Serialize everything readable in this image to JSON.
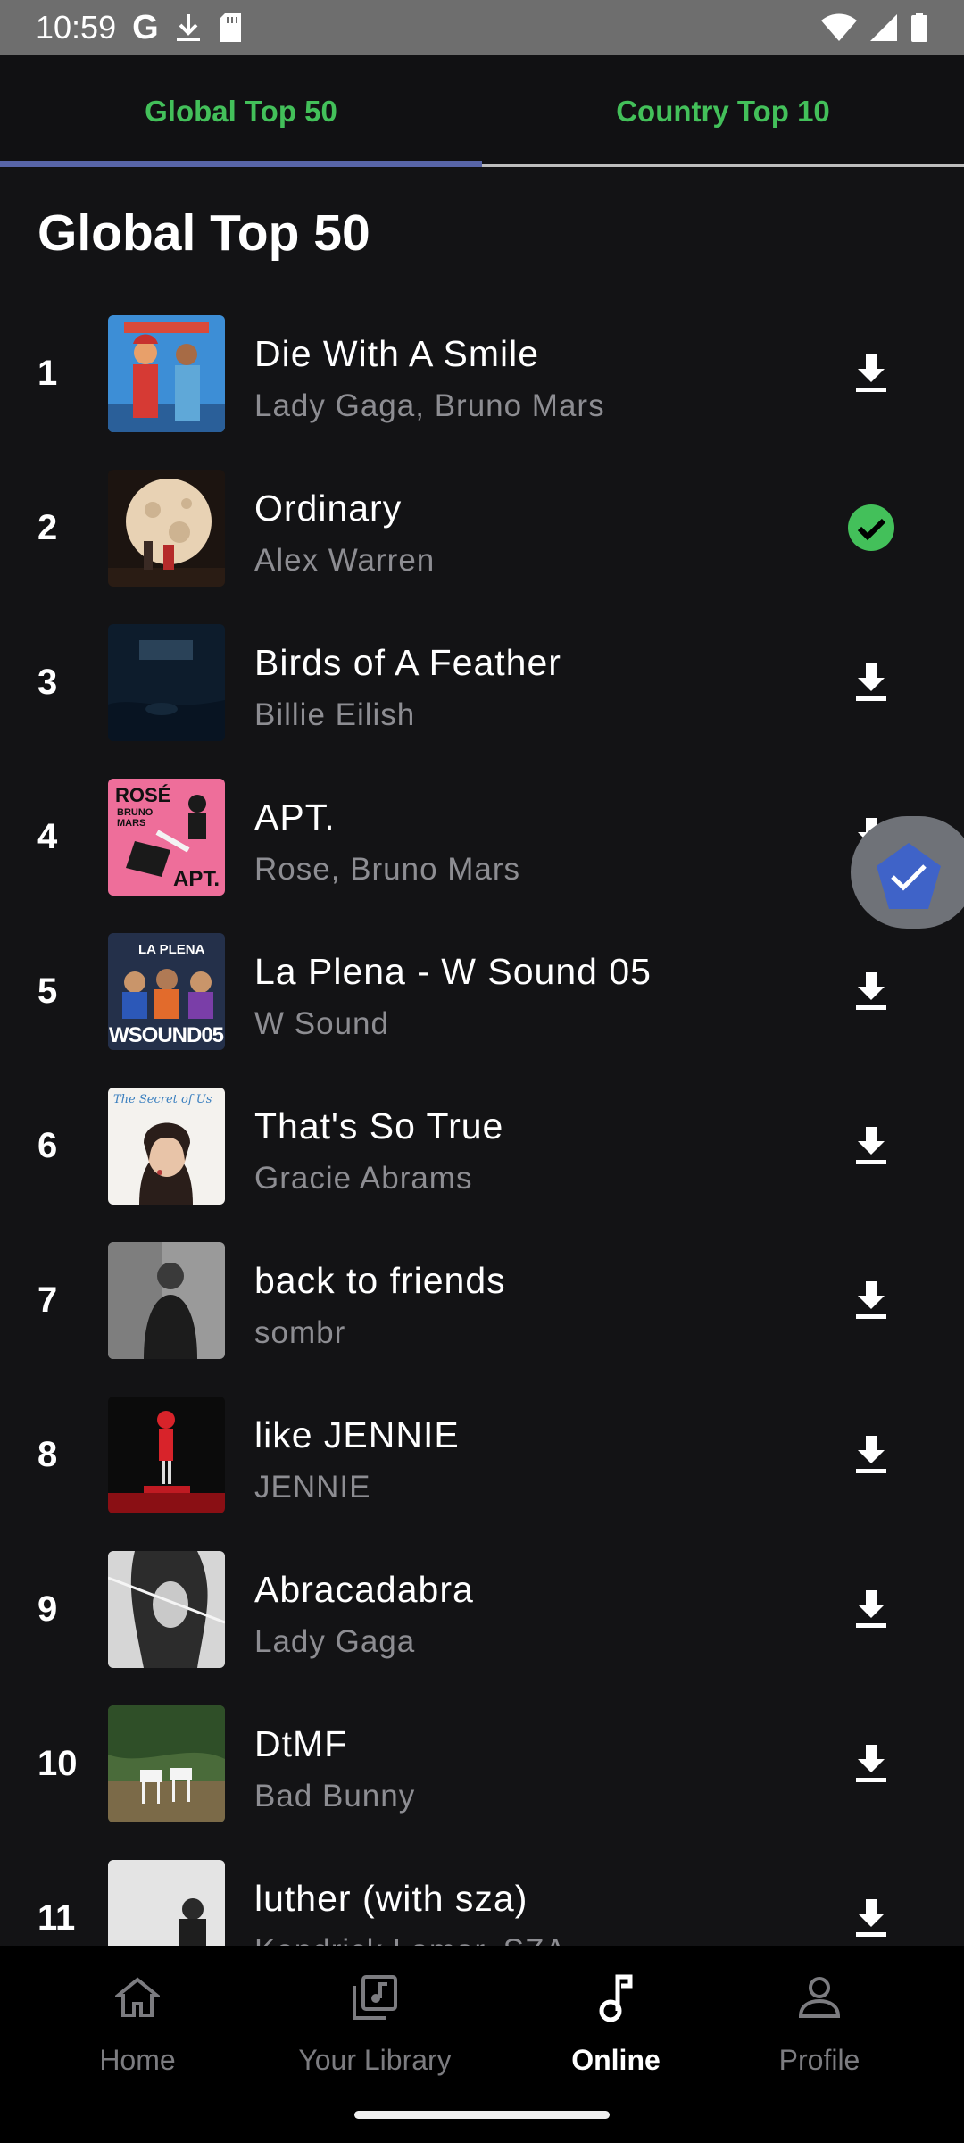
{
  "status_bar": {
    "time": "10:59",
    "g_label": "G"
  },
  "tabs": [
    {
      "label": "Global Top 50",
      "active": true
    },
    {
      "label": "Country Top 10",
      "active": false
    }
  ],
  "section_title": "Global Top 50",
  "colors": {
    "accent_green": "#43c05a",
    "tab_indicator": "#5865a8",
    "background": "#131315"
  },
  "tracks": [
    {
      "rank": "1",
      "title": "Die With A Smile",
      "artist": "Lady Gaga, Bruno Mars",
      "status": "download"
    },
    {
      "rank": "2",
      "title": "Ordinary",
      "artist": "Alex Warren",
      "status": "downloaded"
    },
    {
      "rank": "3",
      "title": "Birds of A Feather",
      "artist": "Billie Eilish",
      "status": "download"
    },
    {
      "rank": "4",
      "title": "APT.",
      "artist": "Rose, Bruno Mars",
      "status": "download"
    },
    {
      "rank": "5",
      "title": "La Plena - W Sound 05",
      "artist": "W Sound",
      "status": "download"
    },
    {
      "rank": "6",
      "title": "That's So True",
      "artist": "Gracie Abrams",
      "status": "download"
    },
    {
      "rank": "7",
      "title": "back to friends",
      "artist": "sombr",
      "status": "download"
    },
    {
      "rank": "8",
      "title": "like JENNIE",
      "artist": "JENNIE",
      "status": "download"
    },
    {
      "rank": "9",
      "title": "Abracadabra",
      "artist": "Lady Gaga",
      "status": "download"
    },
    {
      "rank": "10",
      "title": "DtMF",
      "artist": "Bad Bunny",
      "status": "download"
    },
    {
      "rank": "11",
      "title": "luther (with sza)",
      "artist": "Kendrick Lamar, SZA",
      "status": "download"
    }
  ],
  "album_art_text": {
    "apt_top": "ROSÉ",
    "apt_mid": "BRUNO MARS",
    "apt_bottom": "APT.",
    "laplena_top": "LA PLENA",
    "laplena_bottom": "WSOUND05",
    "sotrue_script": "The Secret of Us"
  },
  "bottom_nav": [
    {
      "label": "Home",
      "icon": "home-icon",
      "active": false
    },
    {
      "label": "Your Library",
      "icon": "library-icon",
      "active": false
    },
    {
      "label": "Online",
      "icon": "music-note-icon",
      "active": true
    },
    {
      "label": "Profile",
      "icon": "profile-icon",
      "active": false
    }
  ]
}
